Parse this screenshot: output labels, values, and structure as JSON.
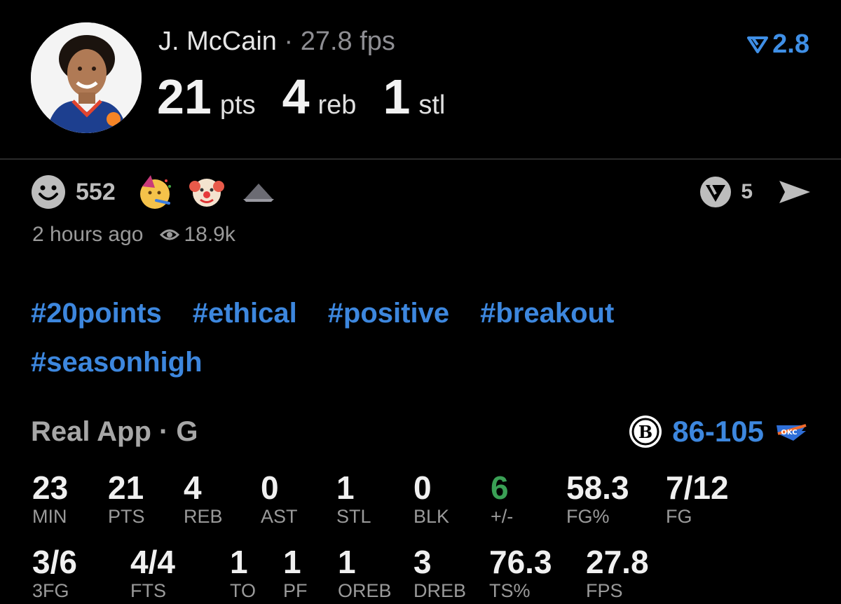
{
  "header": {
    "player_name": "J. McCain",
    "separator": " · ",
    "fps_text": "27.8 fps",
    "points_value": "21",
    "points_unit": "pts",
    "rebounds_value": "4",
    "rebounds_unit": "reb",
    "steals_value": "1",
    "steals_unit": "stl",
    "rating_value": "2.8",
    "rating_icon": "rating-chevron-icon",
    "accent_color": "#3f8fe6"
  },
  "reactions": {
    "count": "552",
    "emojis": [
      "smiley-icon",
      "party-face-icon",
      "clown-face-icon",
      "hat-icon"
    ],
    "share_count": "5",
    "share_icon": "send-arrow-icon",
    "brand_icon": "triangle-badge-icon"
  },
  "meta": {
    "time_ago": "2 hours ago",
    "views": "18.9k"
  },
  "tags": [
    "#20points",
    "#ethical",
    "#positive",
    "#breakout",
    "#seasonhigh"
  ],
  "game": {
    "source": "Real App · G",
    "score_left": "86",
    "score_dash": "-",
    "score_right": "105",
    "away_team_icon": "nets-logo-icon",
    "home_team_icon": "okc-logo-icon"
  },
  "stats_row1": [
    {
      "value": "23",
      "label": "MIN"
    },
    {
      "value": "21",
      "label": "PTS"
    },
    {
      "value": "4",
      "label": "REB"
    },
    {
      "value": "0",
      "label": "AST"
    },
    {
      "value": "1",
      "label": "STL"
    },
    {
      "value": "0",
      "label": "BLK"
    },
    {
      "value": "6",
      "label": "+/-"
    },
    {
      "value": "58.3",
      "label": "FG%"
    },
    {
      "value": "7/12",
      "label": "FG"
    }
  ],
  "stats_row2": [
    {
      "value": "3/6",
      "label": "3FG"
    },
    {
      "value": "4/4",
      "label": "FTS"
    },
    {
      "value": "1",
      "label": "TO"
    },
    {
      "value": "1",
      "label": "PF"
    },
    {
      "value": "1",
      "label": "OREB"
    },
    {
      "value": "3",
      "label": "DREB"
    },
    {
      "value": "76.3",
      "label": "TS%"
    },
    {
      "value": "27.8",
      "label": "FPS"
    }
  ],
  "colors": {
    "positive": "#3aa055",
    "link": "#3d87de"
  }
}
